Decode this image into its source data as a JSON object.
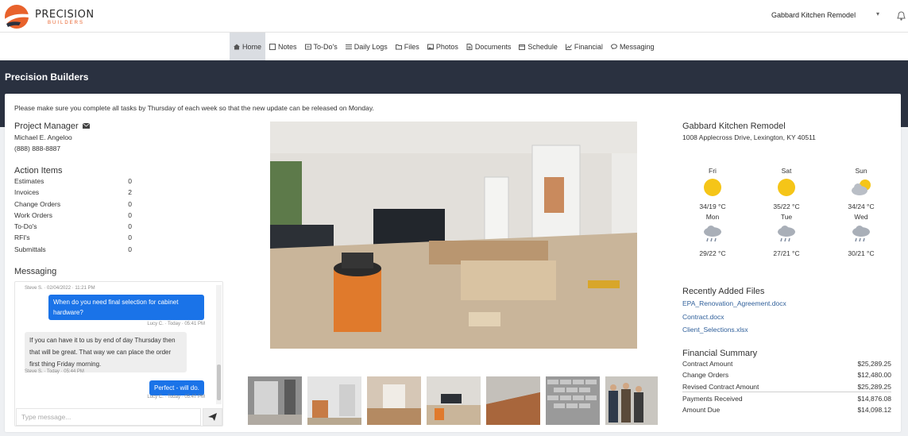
{
  "brand": {
    "name": "PRECISION",
    "sub": "BUILDERS",
    "accent": "#e8622c"
  },
  "project_selector": {
    "value": "Gabbard Kitchen Remodel"
  },
  "nav": {
    "items": [
      {
        "label": "Home",
        "icon": "home-icon",
        "active": true
      },
      {
        "label": "Notes",
        "icon": "note-icon"
      },
      {
        "label": "To-Do's",
        "icon": "checklist-icon"
      },
      {
        "label": "Daily Logs",
        "icon": "list-icon"
      },
      {
        "label": "Files",
        "icon": "folder-icon"
      },
      {
        "label": "Photos",
        "icon": "image-icon"
      },
      {
        "label": "Documents",
        "icon": "document-icon"
      },
      {
        "label": "Schedule",
        "icon": "calendar-icon"
      },
      {
        "label": "Financial",
        "icon": "chart-icon"
      },
      {
        "label": "Messaging",
        "icon": "chat-icon"
      }
    ]
  },
  "page": {
    "title": "Precision Builders"
  },
  "notice": "Please make sure you complete all tasks by Thursday of each week so that the new update can be released on Monday.",
  "project_manager": {
    "title": "Project Manager",
    "name": "Michael E. Angeloo",
    "phone": "(888) 888-8887"
  },
  "action_items": {
    "title": "Action Items",
    "items": [
      {
        "label": "Estimates",
        "value": "0"
      },
      {
        "label": "Invoices",
        "value": "2"
      },
      {
        "label": "Change Orders",
        "value": "0"
      },
      {
        "label": "Work Orders",
        "value": "0"
      },
      {
        "label": "To-Do's",
        "value": "0"
      },
      {
        "label": "RFI's",
        "value": "0"
      },
      {
        "label": "Submittals",
        "value": "0"
      }
    ]
  },
  "messaging": {
    "title": "Messaging",
    "messages": [
      {
        "meta": "Steve S. · 02/04/2022 · 11:21 PM"
      },
      {
        "text": "When do you need final selection for cabinet hardware?",
        "meta": "Lucy C. · Today · 05:41 PM",
        "out": true
      },
      {
        "text": "If you can have it to us by end of day Thursday then that will be great.  That way we can place the order first thing Friday morning.",
        "meta": "Steve S. · Today · 05:44 PM",
        "out": false
      },
      {
        "text": "Perfect - will do.",
        "meta": "Lucy C. · Today · 05:47 PM",
        "out": true
      }
    ],
    "input_placeholder": "Type message..."
  },
  "project": {
    "name": "Gabbard Kitchen Remodel",
    "address": "1008 Applecross Drive, Lexington, KY 40511"
  },
  "weather": [
    {
      "day": "Fri",
      "temp": "34/19 °C",
      "icon": "sun-icon"
    },
    {
      "day": "Sat",
      "temp": "35/22 °C",
      "icon": "sun-icon"
    },
    {
      "day": "Sun",
      "temp": "34/24 °C",
      "icon": "partly-cloudy-icon"
    },
    {
      "day": "Mon",
      "temp": "29/22 °C",
      "icon": "rain-icon"
    },
    {
      "day": "Tue",
      "temp": "27/21 °C",
      "icon": "rain-icon"
    },
    {
      "day": "Wed",
      "temp": "30/21 °C",
      "icon": "rain-icon"
    }
  ],
  "recent_files": {
    "title": "Recently Added Files",
    "files": [
      "EPA_Renovation_Agreement.docx",
      "Contract.docx",
      "Client_Selections.xlsx"
    ]
  },
  "financial": {
    "title": "Financial Summary",
    "rows": [
      {
        "label": "Contract Amount",
        "value": "$25,289.25"
      },
      {
        "label": "Change Orders",
        "value": "$12,480.00"
      },
      {
        "label": "Revised Contract Amount",
        "value": "$25,289.25"
      },
      {
        "label": "Payments Received",
        "value": "$14,876.08"
      },
      {
        "label": "Amount Due",
        "value": "$14,098.12"
      }
    ]
  },
  "colors": {
    "band": "#2a3140",
    "bubble_out": "#1a73e8",
    "link": "#2f5f9a",
    "sun": "#f5c518"
  }
}
